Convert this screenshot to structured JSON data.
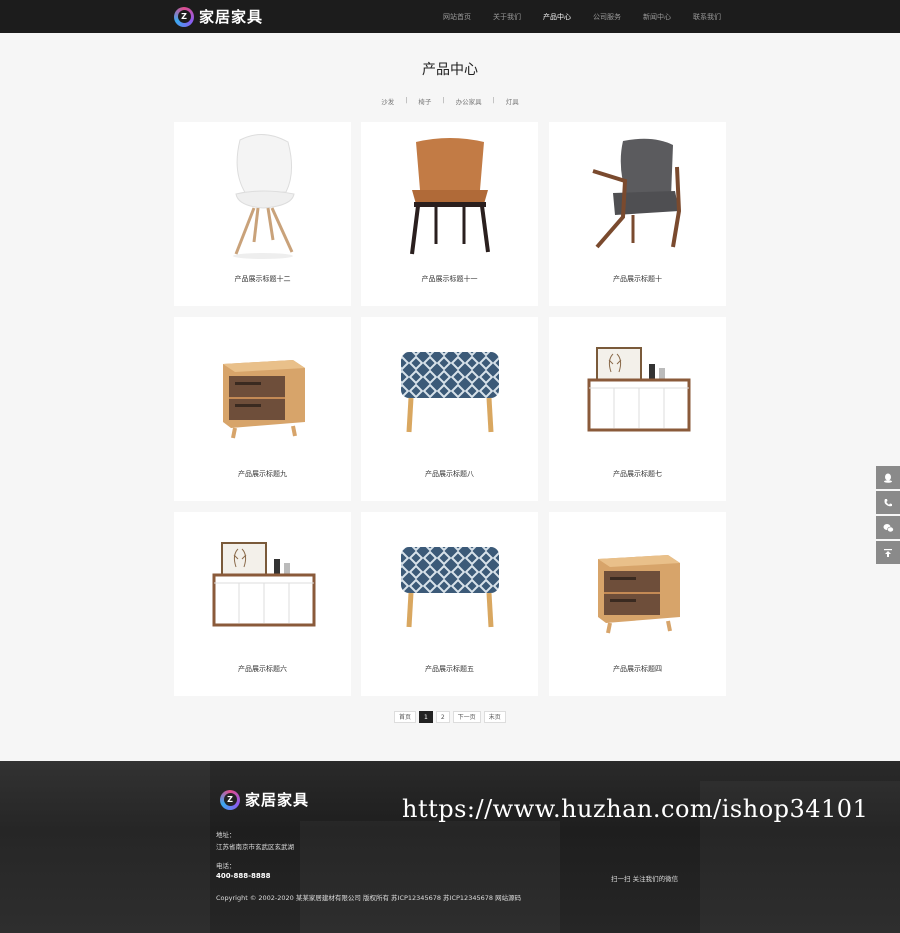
{
  "header": {
    "logo_text": "家居家具",
    "logo_letter": "Z",
    "nav": [
      {
        "label": "网站首页"
      },
      {
        "label": "关于我们"
      },
      {
        "label": "产品中心",
        "active": true
      },
      {
        "label": "公司服务"
      },
      {
        "label": "新闻中心"
      },
      {
        "label": "联系我们"
      }
    ]
  },
  "main": {
    "title": "产品中心",
    "categories": [
      "沙发",
      "椅子",
      "办公家具",
      "灯具"
    ],
    "category_separator": "|",
    "products": [
      {
        "caption": "产品展示标题十二",
        "icon": "white-chair"
      },
      {
        "caption": "产品展示标题十一",
        "icon": "leather-chair"
      },
      {
        "caption": "产品展示标题十",
        "icon": "armchair"
      },
      {
        "caption": "产品展示标题九",
        "icon": "nightstand"
      },
      {
        "caption": "产品展示标题八",
        "icon": "ottoman"
      },
      {
        "caption": "产品展示标题七",
        "icon": "sideboard"
      },
      {
        "caption": "产品展示标题六",
        "icon": "sideboard"
      },
      {
        "caption": "产品展示标题五",
        "icon": "ottoman"
      },
      {
        "caption": "产品展示标题四",
        "icon": "nightstand"
      }
    ],
    "pagination": [
      "首页",
      "1",
      "2",
      "下一页",
      "末页"
    ],
    "current_page": "1"
  },
  "footer": {
    "logo_text": "家居家具",
    "address_label": "地址：",
    "address": "江苏省南京市玄武区玄武湖",
    "phone_label": "电话：",
    "phone": "400-888-8888",
    "copyright": "Copyright © 2002-2020 某某家居建材有限公司 版权所有 苏ICP12345678 苏ICP12345678 网站源码",
    "wechat_text": "扫一扫 关注我们的微信",
    "watermark": "https://www.huzhan.com/ishop34101"
  },
  "float_bar": [
    "qq-icon",
    "phone-icon",
    "wechat-icon",
    "back-to-top-icon"
  ]
}
